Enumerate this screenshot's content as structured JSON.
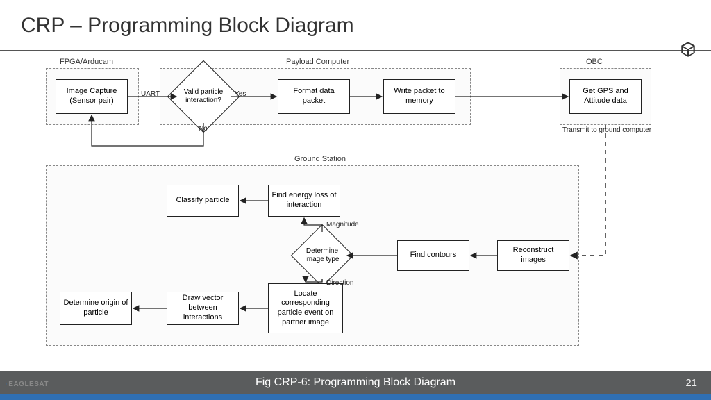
{
  "title": "CRP – Programming Block Diagram",
  "caption": "Fig CRP-6: Programming Block Diagram",
  "page_number": "21",
  "logo": {
    "part1": "EAGLE",
    "part2": "SAT"
  },
  "groups": {
    "fpga": "FPGA/Arducam",
    "payload": "Payload Computer",
    "obc": "OBC",
    "ground": "Ground Station"
  },
  "nodes": {
    "capture": "Image Capture (Sensor pair)",
    "valid": "Valid particle interaction?",
    "format": "Format data packet",
    "write": "Write packet to memory",
    "gps": "Get GPS and Attitude data",
    "classify": "Classify particle",
    "energy": "Find energy loss of interaction",
    "imgtype": "Determine image type",
    "contours": "Find contours",
    "reconstruct": "Reconstruct images",
    "origin": "Determine origin of particle",
    "vector": "Draw vector between interactions",
    "locate": "Locate corresponding particle event on partner image"
  },
  "edges": {
    "uart": "UART",
    "yes": "Yes",
    "no": "No",
    "transmit": "Transmit to ground computer",
    "magnitude": "Magnitude",
    "direction": "Direction"
  }
}
